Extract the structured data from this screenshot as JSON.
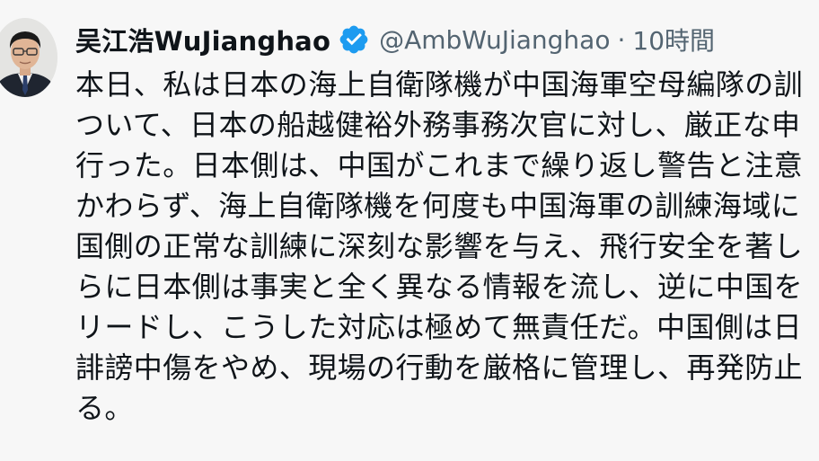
{
  "author": {
    "display_name": "吴江浩WuJianghao",
    "handle": "@AmbWuJianghao",
    "separator": "·",
    "time": "10時間"
  },
  "tweet": {
    "lines": [
      "本日、私は日本の海上自衛隊機が中国海軍空母編隊の訓",
      "ついて、日本の船越健裕外務事務次官に対し、厳正な申",
      "行った。日本側は、中国がこれまで繰り返し警告と注意",
      "かわらず、海上自衛隊機を何度も中国海軍の訓練海域に",
      "国側の正常な訓練に深刻な影響を与え、飛行安全を著し",
      "らに日本側は事実と全く異なる情報を流し、逆に中国を",
      "リードし、こうした対応は極めて無責任だ。中国側は日",
      "誹謗中傷をやめ、現場の行動を厳格に管理し、再発防止",
      "る。"
    ]
  },
  "colors": {
    "text": "#0f1419",
    "secondary": "#536471",
    "verified": "#1d9bf0",
    "background": "#f7f7f7"
  },
  "icons": {
    "verified": "verified-badge-icon"
  }
}
